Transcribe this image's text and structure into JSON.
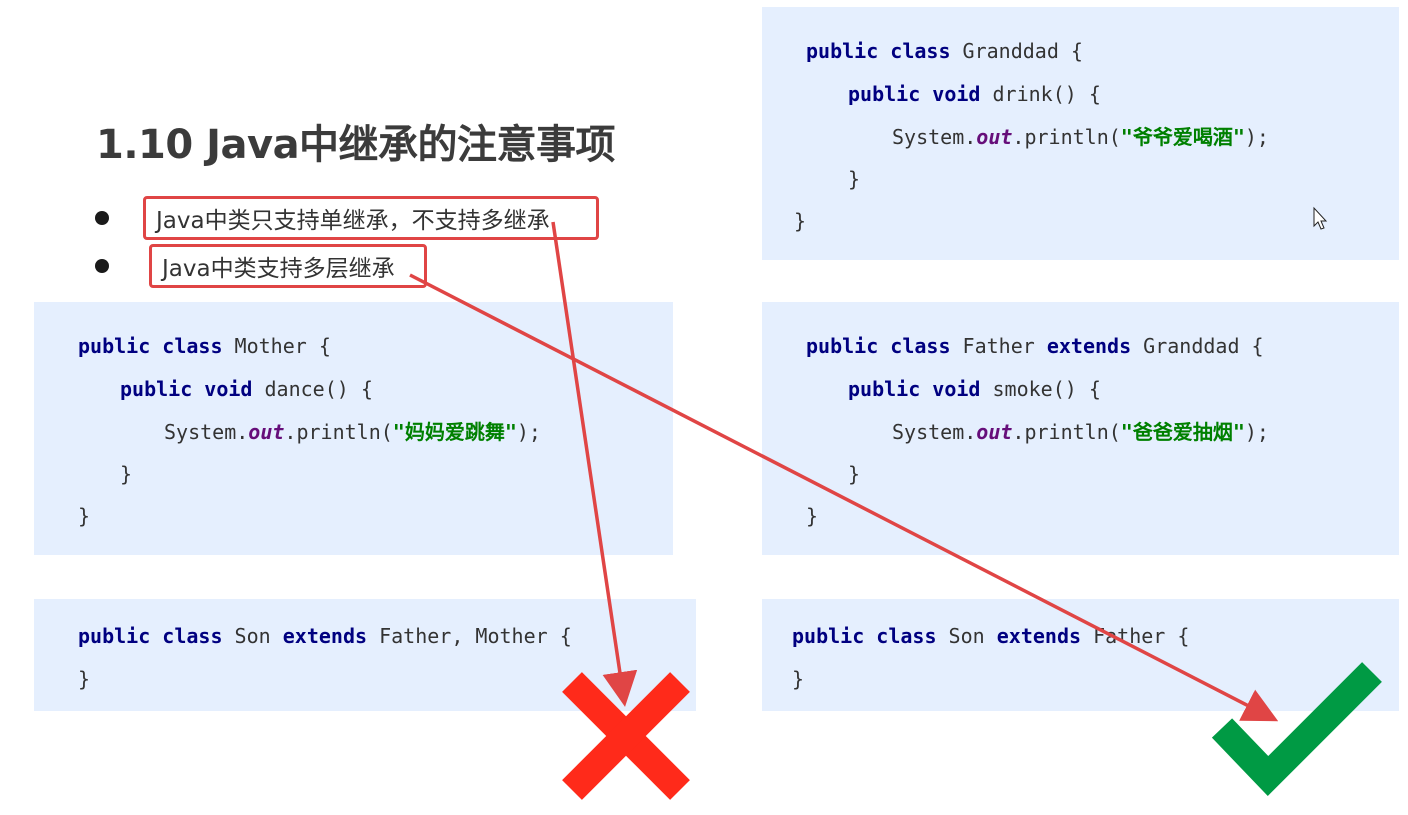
{
  "slide": {
    "title": "1.10 Java中继承的注意事项",
    "bullets": [
      "Java中类只支持单继承，不支持多继承",
      "Java中类支持多层继承"
    ]
  },
  "code": {
    "granddad": {
      "l1_kw1": "public",
      "l1_kw2": "class",
      "l1_rest": " Granddad {",
      "l2_kw1": "public",
      "l2_kw2": "void",
      "l2_rest": " drink() {",
      "l3_pre": "System.",
      "l3_fld": "out",
      "l3_mid": ".println(",
      "l3_str": "\"爷爷爱喝酒\"",
      "l3_post": ");",
      "l4": "}",
      "l5": "}"
    },
    "mother": {
      "l1_kw1": "public",
      "l1_kw2": "class",
      "l1_rest": " Mother {",
      "l2_kw1": "public",
      "l2_kw2": "void",
      "l2_rest": " dance() {",
      "l3_pre": "System.",
      "l3_fld": "out",
      "l3_mid": ".println(",
      "l3_str": "\"妈妈爱跳舞\"",
      "l3_post": ");",
      "l4": "}",
      "l5": "}"
    },
    "father": {
      "l1_kw1": "public",
      "l1_kw2": "class",
      "l1_mid": " Father ",
      "l1_kw3": "extends",
      "l1_rest": " Granddad {",
      "l2_kw1": "public",
      "l2_kw2": "void",
      "l2_rest": " smoke() {",
      "l3_pre": "System.",
      "l3_fld": "out",
      "l3_mid": ".println(",
      "l3_str": "\"爸爸爱抽烟\"",
      "l3_post": ");",
      "l4": "}",
      "l5": "}"
    },
    "son_invalid": {
      "l1_kw1": "public",
      "l1_kw2": "class",
      "l1_mid": " Son ",
      "l1_kw3": "extends",
      "l1_rest": " Father, Mother {",
      "l2": "}"
    },
    "son_valid": {
      "l1_kw1": "public",
      "l1_kw2": "class",
      "l1_mid": " Son ",
      "l1_kw3": "extends",
      "l1_rest": " Father {",
      "l2": "}"
    }
  },
  "colors": {
    "annotation_red": "#e04545",
    "cross_red": "#ff2a1a",
    "check_green": "#009a44",
    "code_bg": "#e5effe"
  },
  "icons": {
    "cross": "cross-mark-icon",
    "check": "check-mark-icon",
    "cursor": "mouse-cursor-icon"
  }
}
